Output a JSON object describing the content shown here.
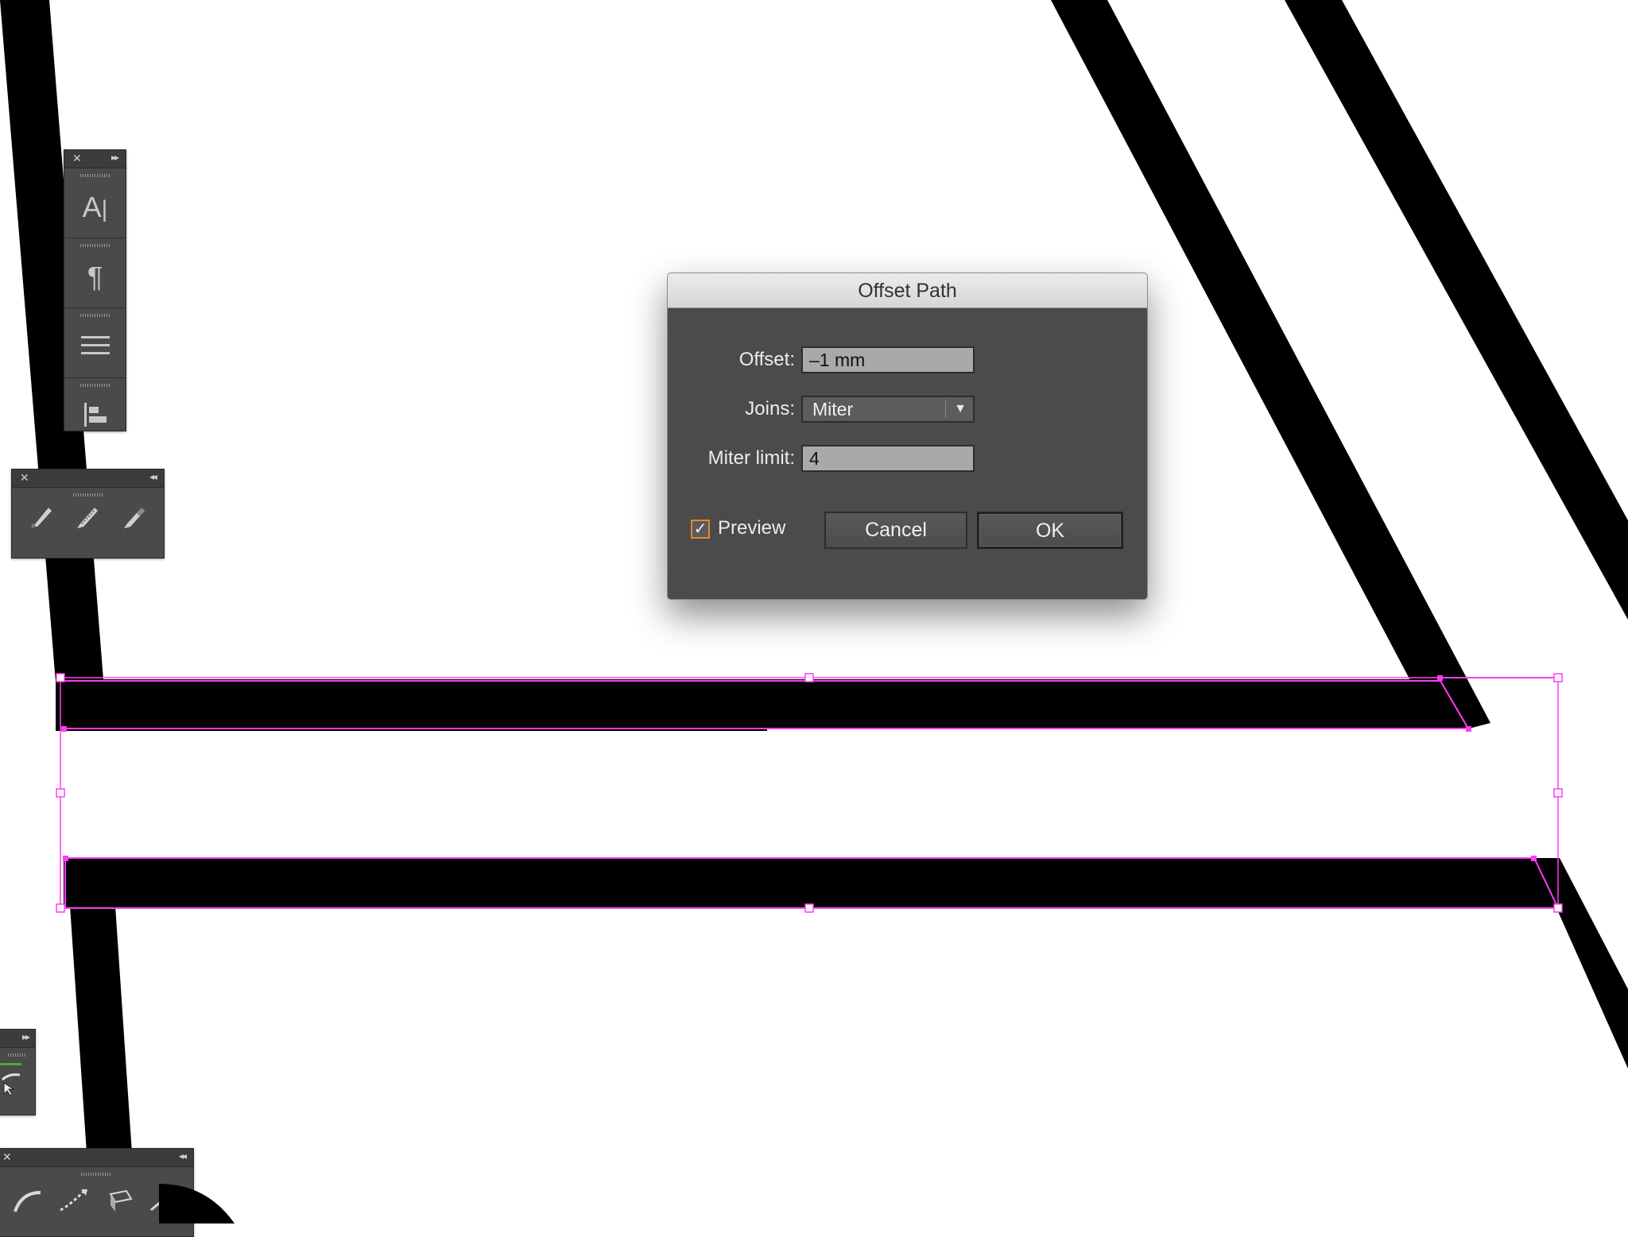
{
  "dialog": {
    "title": "Offset Path",
    "offset_label": "Offset:",
    "offset_value": "–1 mm",
    "joins_label": "Joins:",
    "joins_value": "Miter",
    "miter_limit_label": "Miter limit:",
    "miter_limit_value": "4",
    "preview_label": "Preview",
    "preview_checked": true,
    "cancel_label": "Cancel",
    "ok_label": "OK"
  },
  "colors": {
    "selection": "#ff3cf5",
    "stroke": "#000000",
    "panel_bg": "#4a4a4a",
    "checkbox_focus": "#e08a2a"
  },
  "panels": {
    "type_panel": {
      "icons": [
        "character-icon",
        "paragraph-icon",
        "align-lines-icon",
        "align-objects-icon"
      ],
      "glyphs": {
        "character": "A",
        "paragraph": "¶"
      }
    },
    "brush_panel": {
      "icons": [
        "pencil-icon",
        "brush-icon",
        "eraser-icon"
      ]
    },
    "path_panel": {
      "icons": [
        "width-tool-icon",
        "warp-tool-icon",
        "perspective-grid-icon",
        "graph-tool-icon"
      ]
    }
  }
}
